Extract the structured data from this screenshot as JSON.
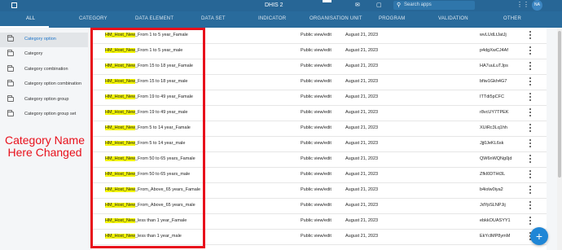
{
  "header": {
    "app_name": "DHIS 2",
    "search_placeholder": "Search apps",
    "avatar_initials": "NA"
  },
  "tabs": [
    "ALL",
    "CATEGORY",
    "DATA ELEMENT",
    "DATA SET",
    "INDICATOR",
    "ORGANISATION UNIT",
    "PROGRAM",
    "VALIDATION",
    "OTHER"
  ],
  "sidebar": {
    "items": [
      {
        "label": "Category option",
        "active": true
      },
      {
        "label": "Category",
        "active": false
      },
      {
        "label": "Category combination",
        "active": false
      },
      {
        "label": "Category option combination",
        "active": false
      },
      {
        "label": "Category option group",
        "active": false
      },
      {
        "label": "Category option group set",
        "active": false
      }
    ]
  },
  "annotation": {
    "line1": "Category Name",
    "line2": "Here Changed"
  },
  "rows": [
    {
      "prefix": "HM_Host_New",
      "name": "_From 1 to 5 year_Famale",
      "sharing": "Public view/edit",
      "date": "August 21, 2023",
      "code": "wvLUdLtJatJj"
    },
    {
      "prefix": "HM_Host_New",
      "name": "_From 1 to 5 year_male",
      "sharing": "Public view/edit",
      "date": "August 21, 2023",
      "code": "p4dgXwCJ4Af"
    },
    {
      "prefix": "HM_Host_New",
      "name": "_From 15 to 18 year_Famale",
      "sharing": "Public view/edit",
      "date": "August 21, 2023",
      "code": "HA7uuLuTJps"
    },
    {
      "prefix": "HM_Host_New",
      "name": "_From 15 to 18 year_male",
      "sharing": "Public view/edit",
      "date": "August 21, 2023",
      "code": "bfiw1Gkh4G7"
    },
    {
      "prefix": "HM_Host_New",
      "name": "_From 19 to 49 year_Famale",
      "sharing": "Public view/edit",
      "date": "August 21, 2023",
      "code": "ITTdi5pCFC"
    },
    {
      "prefix": "HM_Host_New",
      "name": "_From 19 to 49 year_male",
      "sharing": "Public view/edit",
      "date": "August 21, 2023",
      "code": "r8vcUY7TPEK"
    },
    {
      "prefix": "HM_Host_New",
      "name": "_From 5 to 14 year_Famale",
      "sharing": "Public view/edit",
      "date": "August 21, 2023",
      "code": "XUiRc3Lq1hh"
    },
    {
      "prefix": "HM_Host_New",
      "name": "_From 5 to 14 year_male",
      "sharing": "Public view/edit",
      "date": "August 21, 2023",
      "code": "Jjj0JeKL6sk"
    },
    {
      "prefix": "HM_Host_New",
      "name": "_From 50 to 65 years_Famale",
      "sharing": "Public view/edit",
      "date": "August 21, 2023",
      "code": "QW6nWQNg0jd"
    },
    {
      "prefix": "HM_Host_New",
      "name": "_From 50 to 65 years_male",
      "sharing": "Public view/edit",
      "date": "August 21, 2023",
      "code": "ZfkI0DTHt3L"
    },
    {
      "prefix": "HM_Host_New",
      "name": "_From_Above_65 years_Famale",
      "sharing": "Public view/edit",
      "date": "August 21, 2023",
      "code": "b4iolw0iya2"
    },
    {
      "prefix": "HM_Host_New",
      "name": "_From_Above_65 years_male",
      "sharing": "Public view/edit",
      "date": "August 21, 2023",
      "code": "JdYpSLNPJij"
    },
    {
      "prefix": "HM_Host_New",
      "name": "_less than 1 year_Famale",
      "sharing": "Public view/edit",
      "date": "August 21, 2023",
      "code": "ebkkOUASYY1"
    },
    {
      "prefix": "HM_Host_New",
      "name": "_less than 1 year_male",
      "sharing": "Public view/edit",
      "date": "August 21, 2023",
      "code": "EkYclMP8ymM"
    }
  ],
  "fab_label": "+",
  "colors": {
    "header_bg": "#276696",
    "tab_bg": "#296b9c",
    "highlight": "#f3f500",
    "annotation_red": "#e8101b",
    "fab_blue": "#1f86d6",
    "active_link": "#1a73c9"
  }
}
